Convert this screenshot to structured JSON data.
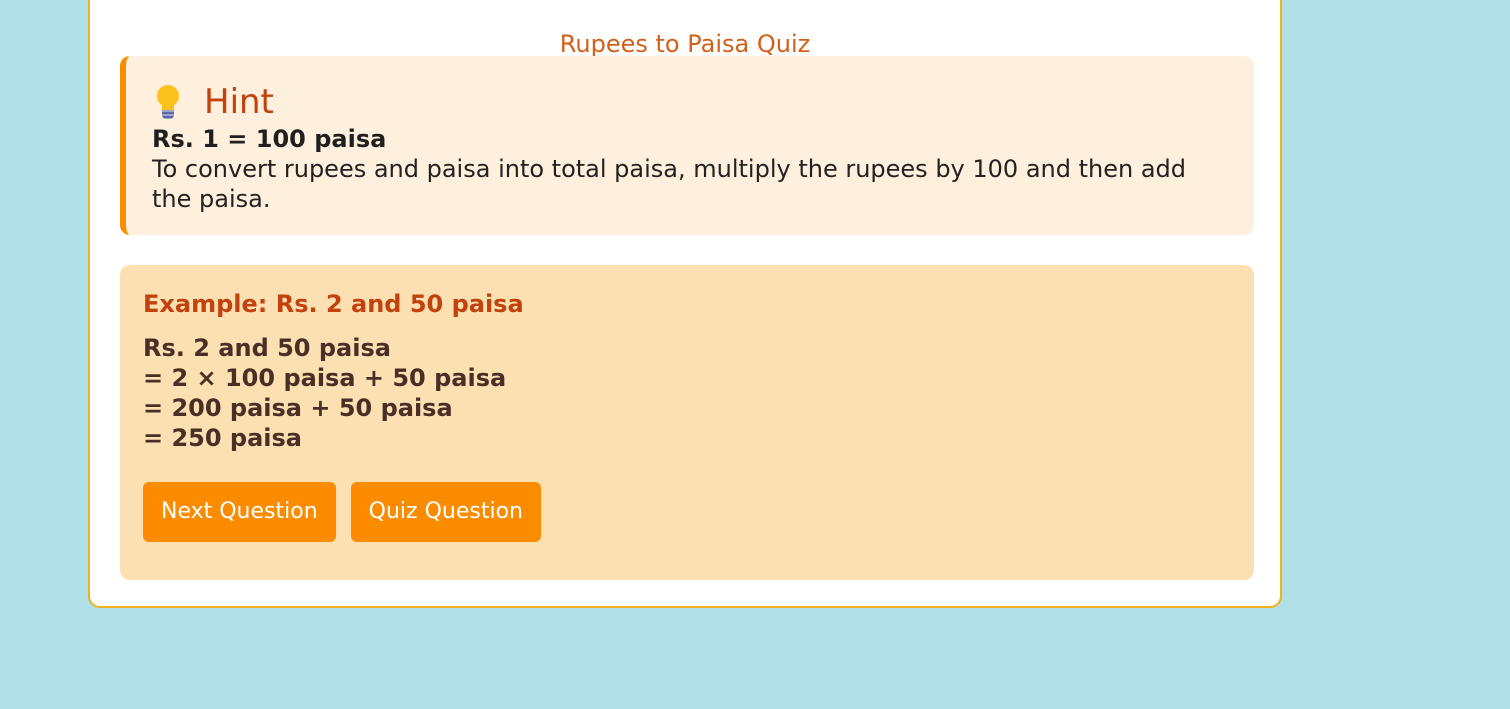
{
  "quiz": {
    "title": "Rupees to Paisa Quiz"
  },
  "hint": {
    "icon": "light-bulb-icon",
    "title": "Hint",
    "rule": "Rs. 1 = 100 paisa",
    "text": "To convert rupees and paisa into total paisa, multiply the rupees by 100 and then add the paisa."
  },
  "example": {
    "title": "Example: Rs. 2 and 50 paisa",
    "lines": [
      "Rs. 2 and 50 paisa",
      "= 2 × 100 paisa + 50 paisa",
      "= 200 paisa + 50 paisa",
      "= 250 paisa"
    ]
  },
  "actions": {
    "next_label": "Next Question",
    "quiz_label": "Quiz Question"
  },
  "colors": {
    "page_background": "#b0dfe5",
    "accent": "#fb8c00",
    "hint_background": "#fef0dc",
    "example_background": "#fde0b2",
    "title_color": "#c2410c"
  }
}
